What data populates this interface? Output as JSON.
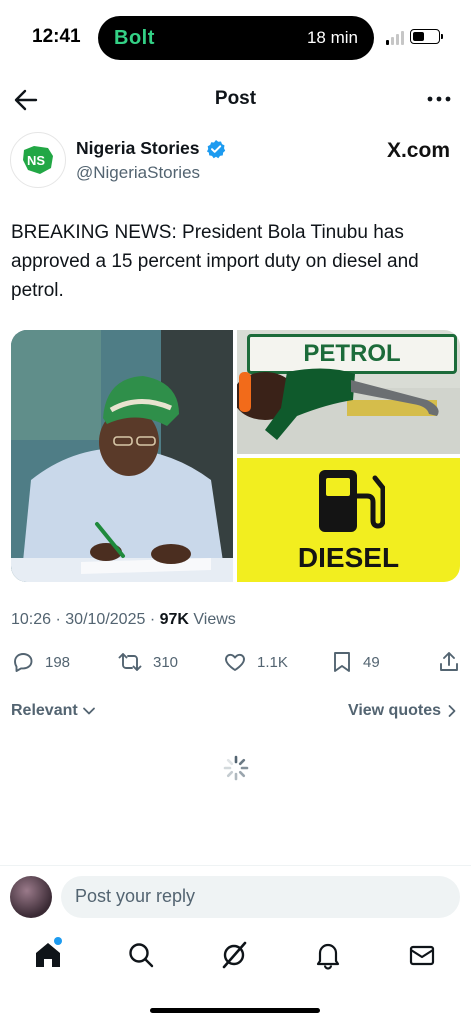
{
  "status_bar": {
    "time": "12:41",
    "live_activity_app": "Bolt",
    "live_activity_eta": "18 min"
  },
  "header": {
    "title": "Post"
  },
  "author": {
    "display_name": "Nigeria Stories",
    "handle": "@NigeriaStories",
    "verified": true,
    "avatar_text": "NS",
    "source_watermark": "X.com"
  },
  "tweet": {
    "text": "BREAKING NEWS: President Bola Tinubu has approved a 15 percent import duty on diesel and petrol.",
    "media": {
      "petrol_sign": "PETROL",
      "diesel_label": "DIESEL"
    },
    "meta": {
      "time": "10:26",
      "date": "30/10/2025",
      "views_count": "97K",
      "views_label": "Views"
    },
    "actions": {
      "replies": "198",
      "reposts": "310",
      "likes": "1.1K",
      "bookmarks": "49"
    }
  },
  "filters": {
    "sort_label": "Relevant",
    "quotes_label": "View quotes"
  },
  "reply_bar": {
    "placeholder": "Post your reply"
  },
  "colors": {
    "accent": "#1d9bf0",
    "text_primary": "#0f1419",
    "text_secondary": "#536471",
    "bolt_green": "#34d186",
    "diesel_yellow": "#f2ee1f"
  }
}
